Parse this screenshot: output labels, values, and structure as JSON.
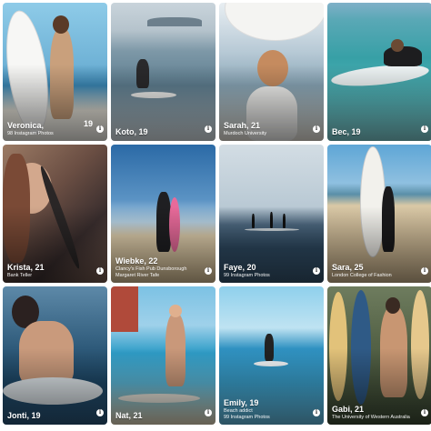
{
  "cards": [
    {
      "name": "Veronica,",
      "age": "19",
      "sub": "98 Instagram Photos",
      "colors": [
        "#7ec6e6",
        "#3f8fb8",
        "#e8e3d8"
      ]
    },
    {
      "name": "Koto, 19",
      "age": "",
      "sub": "",
      "colors": [
        "#b8c6cf",
        "#6f8c9c",
        "#d7dde0"
      ]
    },
    {
      "name": "Sarah, 21",
      "age": "",
      "sub": "Murdoch University",
      "colors": [
        "#dde7ef",
        "#98b3c4",
        "#f2efe8"
      ]
    },
    {
      "name": "Bec, 19",
      "age": "",
      "sub": "",
      "colors": [
        "#8dd2d8",
        "#2f9ca2",
        "#5fb8bf"
      ]
    },
    {
      "name": "Krista, 21",
      "age": "",
      "sub": "Bank Teller",
      "colors": [
        "#8a6a58",
        "#4b3b36",
        "#b08068"
      ]
    },
    {
      "name": "Wiebke, 22",
      "age": "",
      "sub": "Clancy's Fish Pub Dunsborough\nMargaret River Tafe",
      "colors": [
        "#2d6ea8",
        "#8fb7d6",
        "#d6c09a"
      ]
    },
    {
      "name": "Faye, 20",
      "age": "",
      "sub": "99 Instagram Photos",
      "colors": [
        "#c5d3dd",
        "#7894a6",
        "#dfe5e8"
      ]
    },
    {
      "name": "Sara, 25",
      "age": "",
      "sub": "London College of Fashion",
      "colors": [
        "#6eb1dc",
        "#d8c7a8",
        "#c9b18c"
      ]
    },
    {
      "name": "Jonti, 19",
      "age": "",
      "sub": "",
      "colors": [
        "#3d6c8f",
        "#1f4966",
        "#c9a48a"
      ]
    },
    {
      "name": "Nat, 21",
      "age": "",
      "sub": "",
      "colors": [
        "#7cc2e2",
        "#2b9bc6",
        "#e1d4b9"
      ]
    },
    {
      "name": "Emily, 19",
      "age": "",
      "sub": "Beach addict\n99 Instagram Photos",
      "colors": [
        "#8fd0ea",
        "#2f8fbf",
        "#bfe4f0"
      ]
    },
    {
      "name": "Gabi, 21",
      "age": "",
      "sub": "The University of Western Australia",
      "colors": [
        "#6f7a5d",
        "#d6b36a",
        "#3b5b7d"
      ]
    }
  ],
  "info_icon": "info-icon"
}
